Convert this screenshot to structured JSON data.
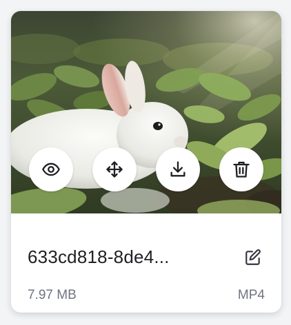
{
  "file_card": {
    "file_name": "633cd818-8de4...",
    "file_size": "7.97 MB",
    "file_type": "MP4",
    "thumbnail_subject": "white rabbit in a vegetable field"
  },
  "actions": [
    {
      "name": "preview",
      "icon": "eye-icon"
    },
    {
      "name": "move",
      "icon": "move-arrows-icon"
    },
    {
      "name": "download",
      "icon": "download-icon"
    },
    {
      "name": "delete",
      "icon": "trash-icon"
    }
  ],
  "edit_icon": "pencil-icon",
  "colors": {
    "text_primary": "#1f1f24",
    "text_secondary": "#6e7382",
    "button_bg": "#ffffff",
    "card_bg": "#ffffff"
  }
}
